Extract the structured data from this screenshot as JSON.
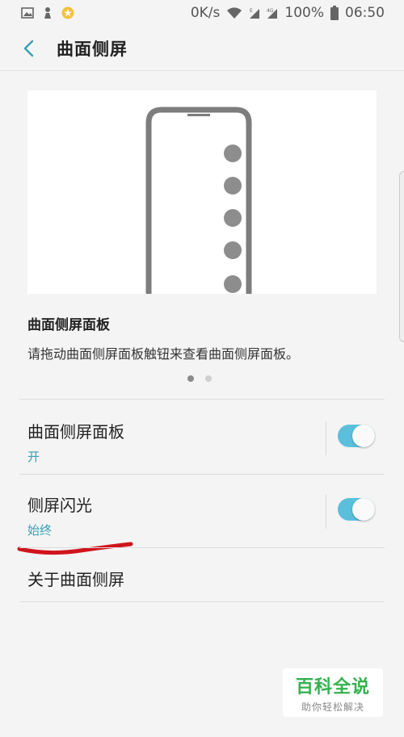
{
  "status_bar": {
    "net_speed": "0K/s",
    "battery": "100%",
    "time": "06:50",
    "icons": [
      "image-icon",
      "notification-icon",
      "star-icon",
      "wifi-icon",
      "signal-e-icon",
      "signal-4g-icon",
      "battery-icon"
    ]
  },
  "app_bar": {
    "title": "曲面侧屏",
    "back_icon": "chevron-left-icon"
  },
  "preview": {
    "panel_title": "曲面侧屏面板",
    "description": "请拖动曲面侧屏面板触钮来查看曲面侧屏面板。",
    "pager": {
      "count": 2,
      "active": 0
    }
  },
  "settings": [
    {
      "label": "曲面侧屏面板",
      "sub": "开",
      "toggle_on": true
    },
    {
      "label": "侧屏闪光",
      "sub": "始终",
      "toggle_on": true
    }
  ],
  "about": {
    "label": "关于曲面侧屏"
  },
  "watermark": {
    "title": "百科全说",
    "subtitle": "助你轻松解决"
  },
  "colors": {
    "accent": "#5bbfdc",
    "sub_text": "#3a9fb3",
    "annotation": "#d0141d",
    "watermark": "#34b24d"
  }
}
